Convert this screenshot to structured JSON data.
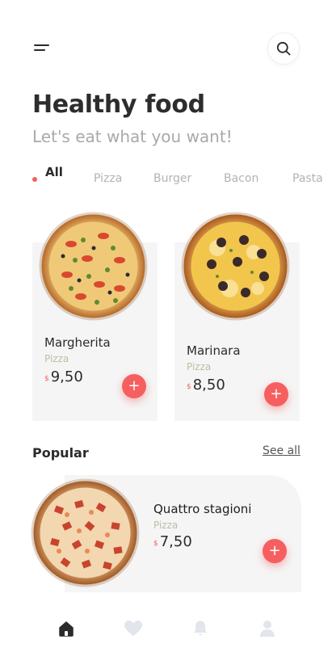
{
  "header": {
    "menu_icon": "menu-icon",
    "search_icon": "search-icon",
    "title": "Healthy food",
    "subtitle": "Let's eat what you want!"
  },
  "categories": {
    "items": [
      "All",
      "Pizza",
      "Burger",
      "Bacon",
      "Pasta"
    ],
    "selected": "All"
  },
  "featured": [
    {
      "name": "Margherita",
      "category": "Pizza",
      "currency": "$",
      "price": "9,50"
    },
    {
      "name": "Marinara",
      "category": "Pizza",
      "currency": "$",
      "price": "8,50"
    }
  ],
  "popular": {
    "title": "Popular",
    "see_all": "See all",
    "item": {
      "name": "Quattro stagioni",
      "category": "Pizza",
      "currency": "$",
      "price": "7,50"
    }
  },
  "add_label": "+",
  "bottom_nav": {
    "items": [
      "home-icon",
      "heart-icon",
      "bell-icon",
      "user-icon"
    ],
    "active": "home-icon"
  },
  "colors": {
    "accent": "#f65f5f",
    "text": "#2b2b2b",
    "muted": "#a9a9a9",
    "card_bg": "#f5f5f5",
    "nav_inactive": "#e3e5ec"
  }
}
